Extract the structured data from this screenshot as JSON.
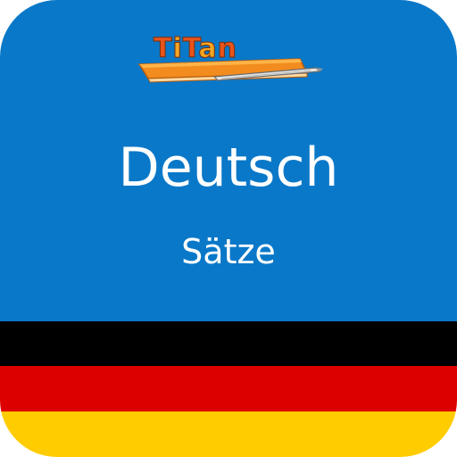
{
  "app_icon": {
    "logo": {
      "letters": [
        {
          "char": "T",
          "color": "#e8541c"
        },
        {
          "char": "i",
          "color": "#f5a623"
        },
        {
          "char": "T",
          "color": "#e8541c"
        },
        {
          "char": "a",
          "color": "#f5a623"
        },
        {
          "char": "n",
          "color": "#e8541c"
        }
      ],
      "book_icon": "book-with-pen-icon"
    },
    "title": "Deutsch",
    "subtitle": "Sätze",
    "colors": {
      "background": "#0a78c8",
      "flag_black": "#000000",
      "flag_red": "#dd0000",
      "flag_gold": "#ffcc00",
      "text": "#ffffff"
    }
  }
}
